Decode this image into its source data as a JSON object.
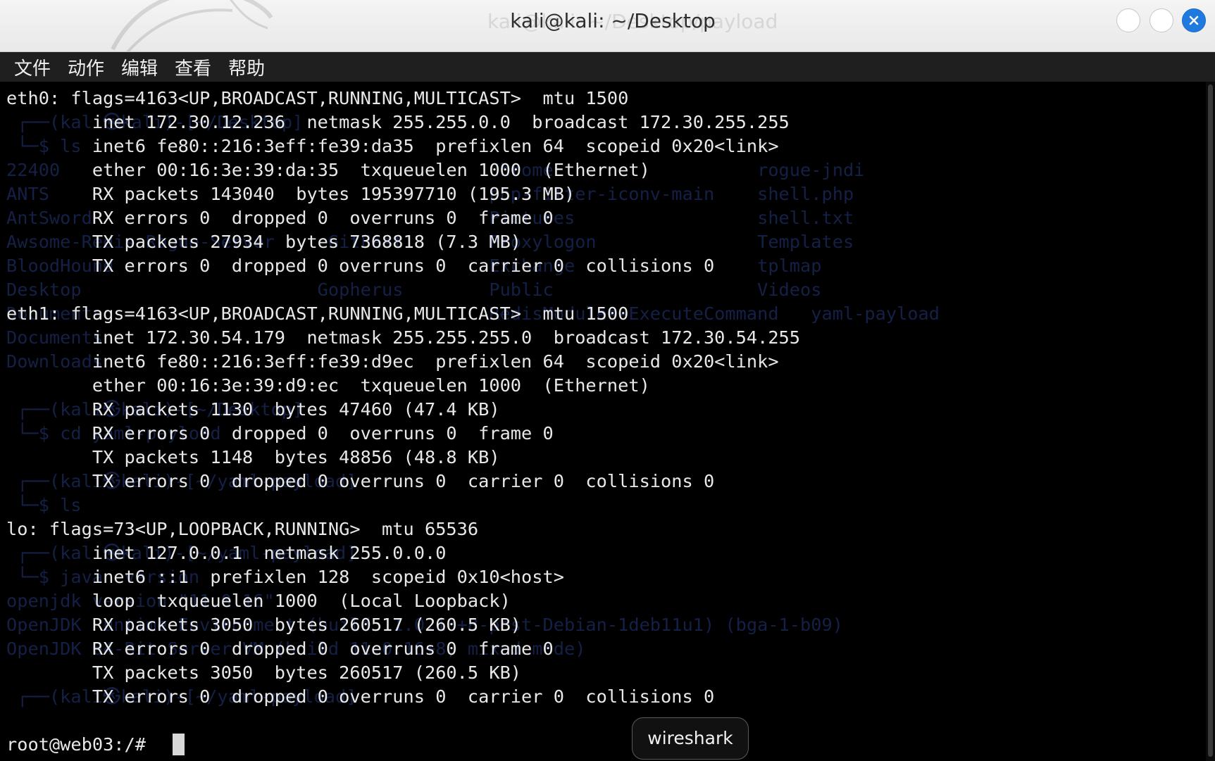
{
  "window": {
    "title": "kali@kali: ~/Desktop",
    "title_ghost": "kali@kali: ~/Desktop/payload"
  },
  "menubar": {
    "items": [
      "文件",
      "动作",
      "编辑",
      "查看",
      "帮助"
    ]
  },
  "terminal": {
    "background_lines": [
      "",
      " ┌──(kali㉿kali)-[~/Desktop]",
      " └─$ ls",
      "22400                                        Chrome                   rogue-jndi",
      "ANTS                                         php-filter-iconv-main    shell.php",
      "AntSword                                     Pictures                 shell.txt",
      "Awsome-Redis-Rogue-Server     GitFast        Proxylogon               Templates",
      "BloodHound                                   Exchange                 tplmap",
      "Desktop                      Gopherus        Public                   Videos",
      "Documents                                    RedisModules-ExecuteCommand   yaml-payload",
      "Documents",
      "Downloads",
      "",
      " ┌──(kali㉿kali)-[~/Desktop]",
      " └─$ cd yaml-payload",
      "",
      " ┌──(kali㉿kali)-[~/yaml-payload]",
      " └─$ ls",
      "",
      " ┌──(kali㉿kali)-[~/yaml-payload]",
      " └─$ java -version",
      "openjdk version \"11.0.16\"",
      "OpenJDK Runtime Environment (build 11.0.16+8-post-Debian-1deb11u1) (bga-1-b09)",
      "OpenJDK 64-Bit Server VM (build 11.0.16+8, mixed mode)",
      "",
      " ┌──(kali㉿kali)-[~/yaml-payload]"
    ],
    "output_lines": [
      "eth0: flags=4163<UP,BROADCAST,RUNNING,MULTICAST>  mtu 1500",
      "        inet 172.30.12.236  netmask 255.255.0.0  broadcast 172.30.255.255",
      "        inet6 fe80::216:3eff:fe39:da35  prefixlen 64  scopeid 0x20<link>",
      "        ether 00:16:3e:39:da:35  txqueuelen 1000  (Ethernet)",
      "        RX packets 143040  bytes 195397710 (195.3 MB)",
      "        RX errors 0  dropped 0  overruns 0  frame 0",
      "        TX packets 27934  bytes 7368818 (7.3 MB)",
      "        TX errors 0  dropped 0 overruns 0  carrier 0  collisions 0",
      "",
      "eth1: flags=4163<UP,BROADCAST,RUNNING,MULTICAST>  mtu 1500",
      "        inet 172.30.54.179  netmask 255.255.255.0  broadcast 172.30.54.255",
      "        inet6 fe80::216:3eff:fe39:d9ec  prefixlen 64  scopeid 0x20<link>",
      "        ether 00:16:3e:39:d9:ec  txqueuelen 1000  (Ethernet)",
      "        RX packets 1130  bytes 47460 (47.4 KB)",
      "        RX errors 0  dropped 0  overruns 0  frame 0",
      "        TX packets 1148  bytes 48856 (48.8 KB)",
      "        TX errors 0  dropped 0 overruns 0  carrier 0  collisions 0",
      "",
      "lo: flags=73<UP,LOOPBACK,RUNNING>  mtu 65536",
      "        inet 127.0.0.1  netmask 255.0.0.0",
      "        inet6 ::1  prefixlen 128  scopeid 0x10<host>",
      "        loop  txqueuelen 1000  (Local Loopback)",
      "        RX packets 3050  bytes 260517 (260.5 KB)",
      "        RX errors 0  dropped 0  overruns 0  frame 0",
      "        TX packets 3050  bytes 260517 (260.5 KB)",
      "        TX errors 0  dropped 0 overruns 0  carrier 0  collisions 0"
    ],
    "prompt": "root@web03:/# "
  },
  "tooltip": {
    "label": "wireshark"
  },
  "icons": {
    "logo": "kali-dragon-icon",
    "close": "close-icon"
  }
}
